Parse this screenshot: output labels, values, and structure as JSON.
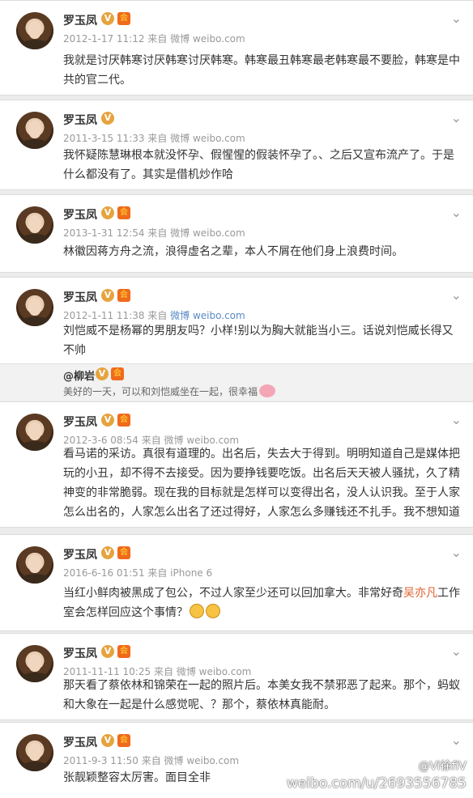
{
  "colors": {
    "card_bg": "#ffffff",
    "page_bg": "#ececec",
    "meta_gray": "#999999",
    "highlight": "#e0622e",
    "badge_orange": "#e6a33e",
    "link_blue": "#5a8ac6"
  },
  "posts": [
    {
      "user": "罗玉凤",
      "time": "2012-1-17 11:12",
      "from": "来自",
      "source": "微博 weibo.com",
      "text": "我就是讨厌韩寒讨厌韩寒讨厌韩寒。韩寒最丑韩寒最老韩寒最不要脸，韩寒是中共的官二代。"
    },
    {
      "user": "罗玉凤",
      "time": "2011-3-15 11:33",
      "from": "来自",
      "source": "微博 weibo.com",
      "text": "我怀疑陈慧琳根本就没怀孕、假惺惺的假装怀孕了。、之后又宣布流产了。于是什么都没有了。其实是借机炒作哈"
    },
    {
      "user": "罗玉凤",
      "time": "2013-1-31 12:54",
      "from": "来自",
      "source": "微博 weibo.com",
      "text": "林徽因蒋方舟之流，浪得虚名之辈，本人不屑在他们身上浪费时间。"
    },
    {
      "user": "罗玉凤",
      "time": "2012-1-11 11:38",
      "from": "来自",
      "source": "微博 weibo.com",
      "text": "刘恺威不是杨幂的男朋友吗？小样!别以为胸大就能当小三。话说刘恺威长得又不帅",
      "repost": {
        "user": "@柳岩",
        "text": "美好的一天，可以和刘恺威坐在一起，很幸福"
      }
    },
    {
      "user": "罗玉凤",
      "time": "2012-3-6 08:54",
      "from": "来自",
      "source": "微博 weibo.com",
      "text": "看马诺的采访。真很有道理的。出名后，失去大于得到。明明知道自己是媒体把玩的小丑，却不得不去接受。因为要挣钱要吃饭。出名后天天被人骚扰，久了精神变的非常脆弱。现在我的目标就是怎样可以变得出名，没人认识我。至于人家怎么出名的，人家怎么出名了还过得好，人家怎么多赚钱还不扎手。我不想知道"
    },
    {
      "user": "罗玉凤",
      "time": "2016-6-16 01:51",
      "from": "来自",
      "source": "iPhone 6",
      "text_before": "当红小鲜肉被黑成了包公，不过人家至少还可以回加拿大。非常好奇",
      "text_highlight": "吴亦凡",
      "text_after": "工作室会怎样回应这个事情？"
    },
    {
      "user": "罗玉凤",
      "time": "2011-11-11 10:25",
      "from": "来自",
      "source": "微博 weibo.com",
      "text": "那天看了蔡依林和锦荣在一起的照片后。本美女我不禁邪恶了起来。那个，蚂蚁和大象在一起是什么感觉呢、？那个，蔡依林真能耐。"
    },
    {
      "user": "罗玉凤",
      "time": "2011-9-3 11:50",
      "from": "来自",
      "source": "微博 weibo.com",
      "text": "张靓颖整容太厉害。面目全非"
    }
  ],
  "watermark": {
    "handle": "@Vi徐fiV",
    "url": "weibo.com/u/2693556785"
  },
  "icons": {
    "verified": "V",
    "vip": "会",
    "chevron": "chevron-down-icon"
  }
}
